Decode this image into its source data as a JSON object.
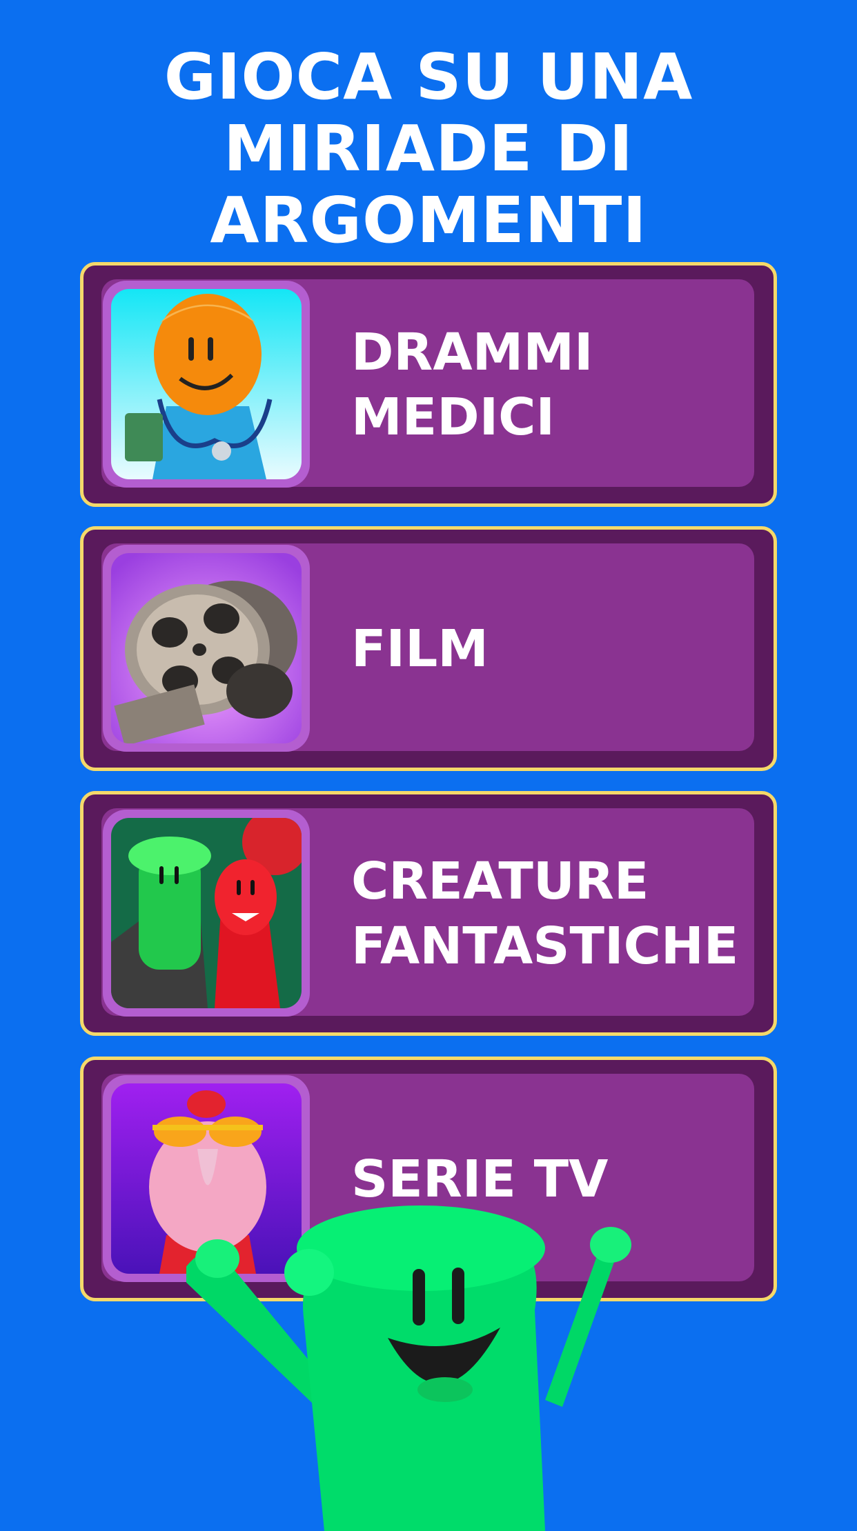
{
  "headline": {
    "line1": "GIOCA SU UNA",
    "line2": "MIRIADE DI ARGOMENTI"
  },
  "topics": [
    {
      "line1": "DRAMMI",
      "line2": "MEDICI",
      "icon": "doctor-icon"
    },
    {
      "line1": "FILM",
      "line2": "",
      "icon": "film-reel-icon"
    },
    {
      "line1": "CREATURE",
      "line2": "FANTASTICHE",
      "icon": "monsters-icon"
    },
    {
      "line1": "SERIE TV",
      "line2": "",
      "icon": "turkey-icon"
    }
  ],
  "colors": {
    "background": "#0b6ff0",
    "card_border": "#f5d96a",
    "card_outer": "#5a1a5c",
    "card_inner": "#8a3391",
    "mascot": "#00e46c"
  }
}
